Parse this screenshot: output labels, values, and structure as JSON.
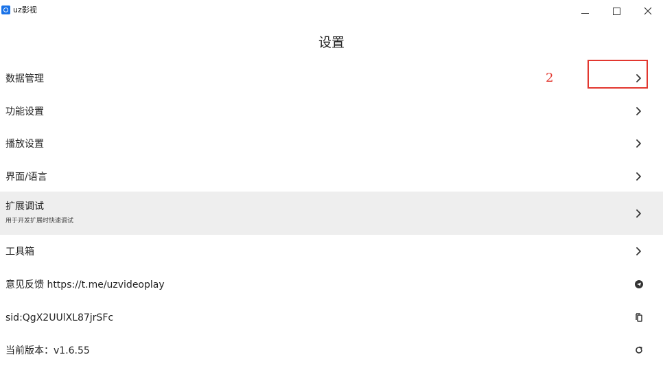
{
  "window": {
    "title": "uz影视",
    "minimize_label": "–",
    "maximize_label": "□",
    "close_label": "×"
  },
  "page": {
    "title": "设置"
  },
  "settings": {
    "data_management": {
      "label": "数据管理"
    },
    "function_settings": {
      "label": "功能设置"
    },
    "playback_settings": {
      "label": "播放设置"
    },
    "interface_language": {
      "label": "界面/语言"
    },
    "extension_debug": {
      "label": "扩展调试",
      "sublabel": "用于开发扩展时快速调试"
    },
    "toolbox": {
      "label": "工具箱"
    },
    "feedback": {
      "label": "意见反馈 https://t.me/uzvideoplay"
    },
    "sid": {
      "label": "sid:QgX2UUlXL87jrSFc"
    },
    "version": {
      "label": "当前版本：v1.6.55"
    }
  },
  "icons": {
    "row_arrow": "chevron-right-icon",
    "feedback": "telegram-icon",
    "sid": "copy-icon",
    "version": "refresh-icon"
  },
  "annotation": {
    "number": "2",
    "color": "#e2372f"
  },
  "colors": {
    "highlight_row": "#eeeeee",
    "app_icon": "#1a73e8"
  }
}
